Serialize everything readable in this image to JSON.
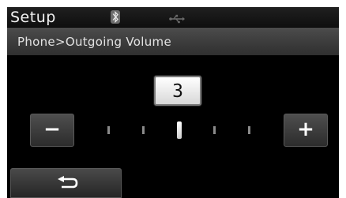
{
  "header": {
    "title": "Setup",
    "icons": [
      "bluetooth-icon",
      "usb-icon"
    ]
  },
  "breadcrumb": {
    "text": "Phone>Outgoing Volume"
  },
  "volume": {
    "value": "3",
    "min": 0,
    "max": 6,
    "minus_label": "−",
    "plus_label": "+"
  },
  "footer": {
    "back_icon": "back-arrow-icon"
  },
  "colors": {
    "background": "#000000",
    "button": "#3a3a3a",
    "text": "#ffffff"
  }
}
